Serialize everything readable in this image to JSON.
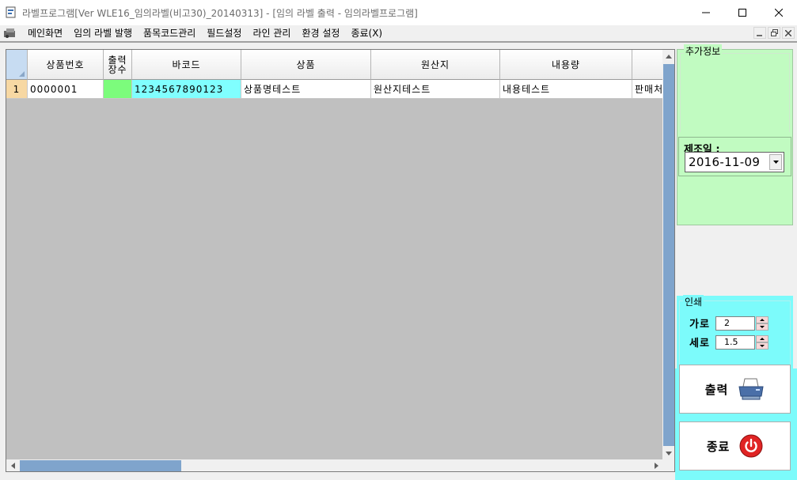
{
  "window": {
    "title": "라벨프로그램[Ver WLE16_임의라벨(비고30)_20140313] - [임의 라벨 출력 - 임의라벨프로그램]"
  },
  "menu": {
    "items": [
      "메인화면",
      "임의 라벨 발행",
      "품목코드관리",
      "필드설정",
      "라인 관리",
      "환경 설정",
      "종료(X)"
    ]
  },
  "grid": {
    "columns": [
      "상품번호",
      "출력\n장수",
      "바코드",
      "상품",
      "원산지",
      "내용량"
    ],
    "rows": [
      {
        "num": "1",
        "product_no": "0000001",
        "count": "",
        "barcode": "1234567890123",
        "product": "상품명테스트",
        "origin": "원산지테스트",
        "content": "내용테스트",
        "seller": "판매처"
      }
    ],
    "colors": {
      "count_cell": "#7cfc7c",
      "barcode_cell": "#80ffff",
      "row_header": "#f7d8a3"
    }
  },
  "extra": {
    "title": "추가정보",
    "mfg_label": "제조일 :",
    "mfg_date": "2016-11-09"
  },
  "print": {
    "title": "인쇄",
    "horizontal_label": "가로",
    "horizontal_value": "2",
    "vertical_label": "세로",
    "vertical_value": "1.5",
    "print_label": "출력",
    "exit_label": "종료"
  }
}
